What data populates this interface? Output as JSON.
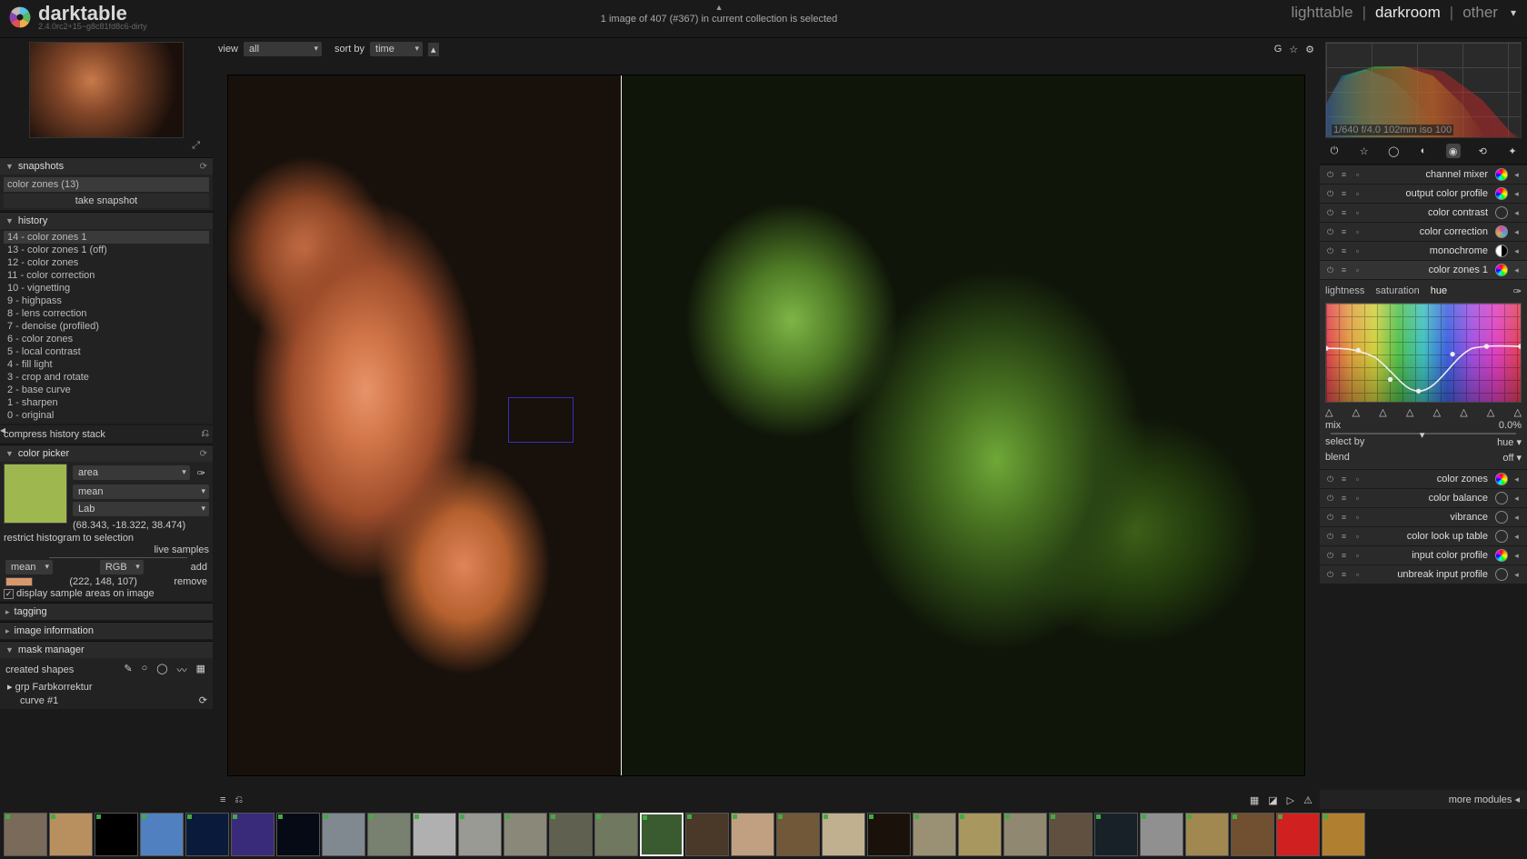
{
  "app": {
    "name": "darktable",
    "version": "2.4.0rc2+15~g8c81fd8c6-dirty"
  },
  "status": "1 image of 407 (#367) in current collection is selected",
  "tabs": {
    "lighttable": "lighttable",
    "darkroom": "darkroom",
    "other": "other",
    "active": "darkroom"
  },
  "view_label": "view",
  "view_value": "all",
  "sort_label": "sort by",
  "sort_value": "time",
  "snapshots": {
    "title": "snapshots",
    "item": "color zones (13)",
    "take": "take snapshot"
  },
  "history": {
    "title": "history",
    "compress": "compress history stack",
    "items": [
      "14 - color zones 1",
      "13 - color zones 1 (off)",
      "12 - color zones",
      "11 - color correction",
      "10 - vignetting",
      "9 - highpass",
      "8 - lens correction",
      "7 - denoise (profiled)",
      "6 - color zones",
      "5 - local contrast",
      "4 - fill light",
      "3 - crop and rotate",
      "2 - base curve",
      "1 - sharpen",
      "0 - original"
    ]
  },
  "picker": {
    "title": "color picker",
    "mode": "area",
    "stat": "mean",
    "space": "Lab",
    "lab": "(68.343, -18.322, 38.474)",
    "restrict": "restrict histogram to selection",
    "live": "live samples",
    "mean": "mean",
    "rgb": "RGB",
    "add": "add",
    "rgbval": "(222, 148, 107)",
    "remove": "remove",
    "display": "display sample areas on image"
  },
  "tagging": {
    "title": "tagging"
  },
  "imginfo": {
    "title": "image information"
  },
  "mask": {
    "title": "mask manager",
    "created": "created shapes",
    "grp": "grp Farbkorrektur",
    "curve": "curve #1"
  },
  "exif": "1/640 f/4.0 102mm iso 100",
  "modules": [
    {
      "label": "channel mixer",
      "ic": "rainbow"
    },
    {
      "label": "output color profile",
      "ic": "rainbow"
    },
    {
      "label": "color contrast",
      "ic": "plain"
    },
    {
      "label": "color correction",
      "ic": "cc"
    },
    {
      "label": "monochrome",
      "ic": "bw"
    },
    {
      "label": "color zones 1",
      "ic": "rainbow",
      "expanded": true
    },
    {
      "label": "color zones",
      "ic": "rainbow"
    },
    {
      "label": "color balance",
      "ic": "plain"
    },
    {
      "label": "vibrance",
      "ic": "plain"
    },
    {
      "label": "color look up table",
      "ic": "plain"
    },
    {
      "label": "input color profile",
      "ic": "rainbow"
    },
    {
      "label": "unbreak input profile",
      "ic": "plain"
    }
  ],
  "cz": {
    "t1": "lightness",
    "t2": "saturation",
    "t3": "hue",
    "mix": "mix",
    "mixv": "0.0%",
    "select": "select by",
    "selv": "hue",
    "blend": "blend",
    "blendv": "off"
  },
  "more": "more modules",
  "fs_colors": [
    "#7a6a5a",
    "#b89060",
    "#000",
    "#5080c0",
    "#0a1a3a",
    "#3a2a7a",
    "#060a14",
    "#808890",
    "#788070",
    "#b0b0b0",
    "#9a9a94",
    "#8a8878",
    "#606050",
    "#707860",
    "#3a5a30",
    "#4a3828",
    "#c0a080",
    "#705838",
    "#c0b090",
    "#1a120a",
    "#9a9074",
    "#a89860",
    "#908870",
    "#605040",
    "#182028",
    "#909090",
    "#a08850",
    "#705030",
    "#d02020",
    "#b08030"
  ]
}
